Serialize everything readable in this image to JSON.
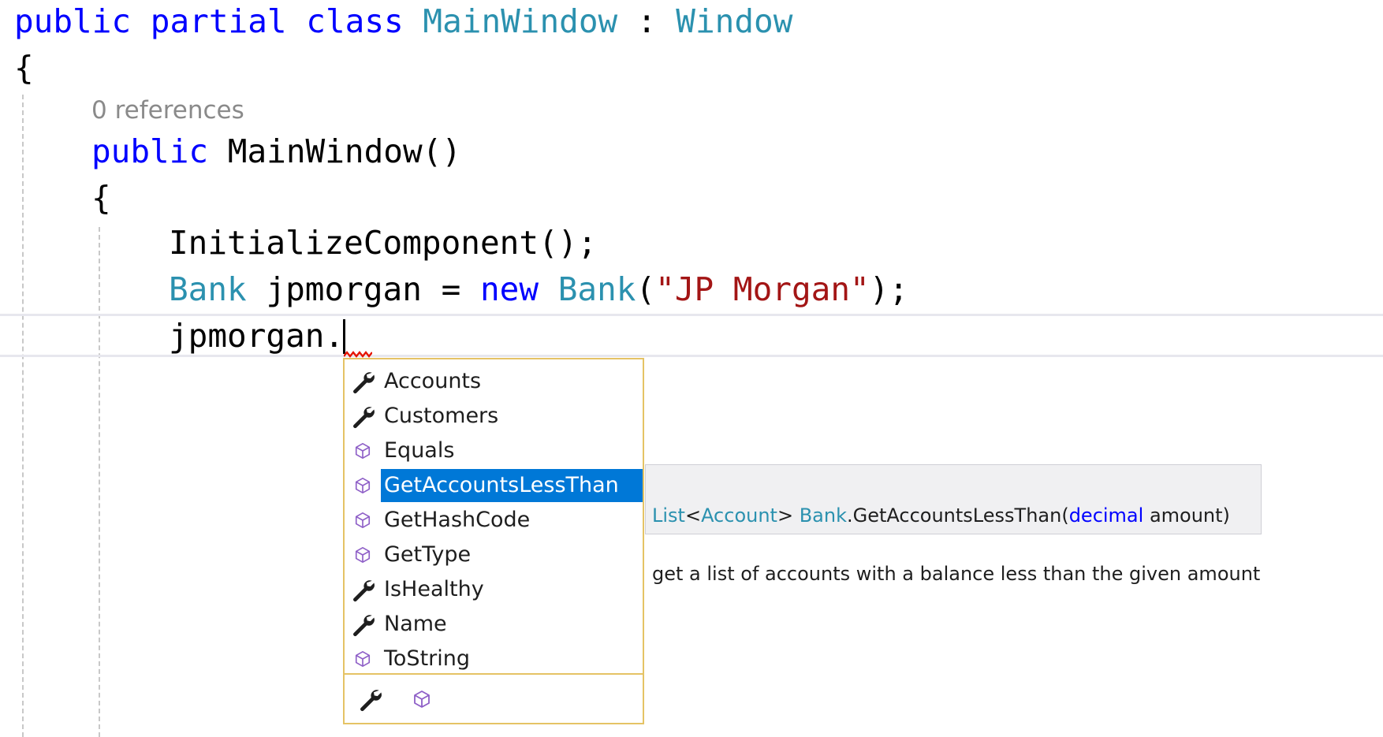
{
  "code": {
    "line1": {
      "kw1": "public",
      "kw2": "partial",
      "kw3": "class",
      "class_name": "MainWindow",
      "colon": ":",
      "base": "Window"
    },
    "line2": "{",
    "codelens": "0 references",
    "line3": {
      "kw": "public",
      "ctor": "MainWindow()"
    },
    "line4": "{",
    "line5": "InitializeComponent();",
    "line6": {
      "type": "Bank",
      "var": "jpmorgan",
      "eq": "=",
      "kw_new": "new",
      "type2": "Bank",
      "open": "(",
      "str": "\"JP Morgan\"",
      "close": ");"
    },
    "line7": "jpmorgan."
  },
  "completion": {
    "items": [
      {
        "label": "Accounts",
        "icon": "wrench-icon"
      },
      {
        "label": "Customers",
        "icon": "wrench-icon"
      },
      {
        "label": "Equals",
        "icon": "cube-icon"
      },
      {
        "label": "GetAccountsLessThan",
        "icon": "cube-icon",
        "selected": true
      },
      {
        "label": "GetHashCode",
        "icon": "cube-icon"
      },
      {
        "label": "GetType",
        "icon": "cube-icon"
      },
      {
        "label": "IsHealthy",
        "icon": "wrench-icon"
      },
      {
        "label": "Name",
        "icon": "wrench-icon"
      },
      {
        "label": "ToString",
        "icon": "cube-icon"
      }
    ],
    "footer_filters": [
      "wrench-icon",
      "cube-icon"
    ]
  },
  "tooltip": {
    "sig_return_type": "List",
    "sig_lt": "<",
    "sig_generic": "Account",
    "sig_gt": ">",
    "sig_owner": "Bank",
    "sig_method": ".GetAccountsLessThan(",
    "sig_param_type": "decimal",
    "sig_param_name": " amount)",
    "description": "get a list of accounts with a balance less than the given amount"
  },
  "colors": {
    "keyword": "#0000ff",
    "type": "#2b91af",
    "string": "#a31515",
    "selection": "#0078d7",
    "popup_border": "#e5c365"
  }
}
